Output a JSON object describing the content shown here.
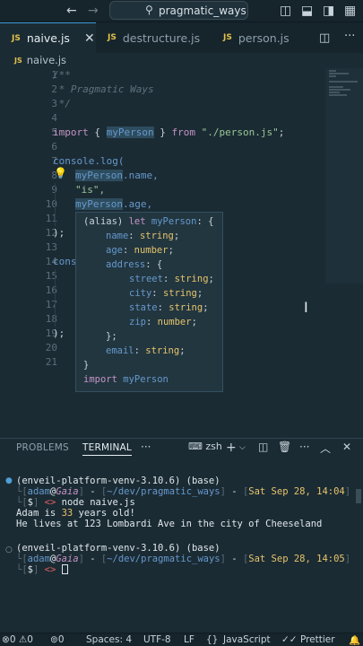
{
  "titlebar": {
    "search_icon": "search-icon",
    "search_text": "pragmatic_ways"
  },
  "tabs": [
    {
      "badge": "JS",
      "label": "naive.js",
      "active": true
    },
    {
      "badge": "JS",
      "label": "destructure.js",
      "active": false
    },
    {
      "badge": "JS",
      "label": "person.js",
      "active": false
    }
  ],
  "breadcrumb": {
    "badge": "JS",
    "file": "naive.js"
  },
  "editor": {
    "line_numbers": [
      "1",
      "2",
      "3",
      "4",
      "5",
      "6",
      "7",
      "8",
      "9",
      "10",
      "11",
      "12",
      "13",
      "14",
      "15",
      "16",
      "17",
      "18",
      "19",
      "20",
      "21"
    ],
    "line1": "/**",
    "line2": " * Pragmatic Ways",
    "line3": " */",
    "line5_import": "import",
    "line5_open": " { ",
    "line5_var": "myPerson",
    "line5_close": " } ",
    "line5_from": "from",
    "line5_path": " \"./person.js\"",
    "line5_end": ";",
    "line7": "console.log(",
    "line8_var": "myPerson",
    "line8_rest": ".name,",
    "line9": "\"is\",",
    "line10_var": "myPerson",
    "line10_rest": ".age,",
    "line12": ");",
    "line14": "cons",
    "line19": ");"
  },
  "hover": {
    "l1_a": "(alias) ",
    "l1_b": "let ",
    "l1_c": "myPerson",
    "l1_d": ": {",
    "name_key": "name",
    "name_type": "string",
    "age_key": "age",
    "age_type": "number",
    "address_key": "address",
    "street_key": "street",
    "street_type": "string",
    "city_key": "city",
    "city_type": "string",
    "state_key": "state",
    "state_type": "string",
    "zip_key": "zip",
    "zip_type": "number",
    "close_inner": "};",
    "email_key": "email",
    "email_type": "string",
    "close_outer": "}",
    "import_kw": "import ",
    "import_var": "myPerson"
  },
  "panel": {
    "tabs": [
      "PROBLEMS",
      "TERMINAL"
    ],
    "more": "···",
    "shell": "zsh",
    "term": {
      "env1": "(enveil-platform-venv-3.10.6) (base)",
      "user": "adam",
      "host": "Gaia",
      "path": "~/dev/pragmatic_ways",
      "date1": "Sat Sep 28, 14:04",
      "prompt": "$",
      "cmd": "node naive.js",
      "out1_a": "Adam is ",
      "out1_num": "33",
      "out1_b": " years old!",
      "out2": "He lives at 123 Lombardi Ave in the city of Cheeseland",
      "env2": "(enveil-platform-venv-3.10.6) (base)",
      "date2": "Sat Sep 28, 14:05"
    }
  },
  "statusbar": {
    "problems": "0",
    "warnings": "0",
    "ports": "0",
    "spaces": "Spaces: 4",
    "encoding": "UTF-8",
    "eol": "LF",
    "language": "JavaScript",
    "formatter": "Prettier"
  },
  "colors": {
    "accent": "#3e9bd8",
    "background": "#1b2b34"
  }
}
